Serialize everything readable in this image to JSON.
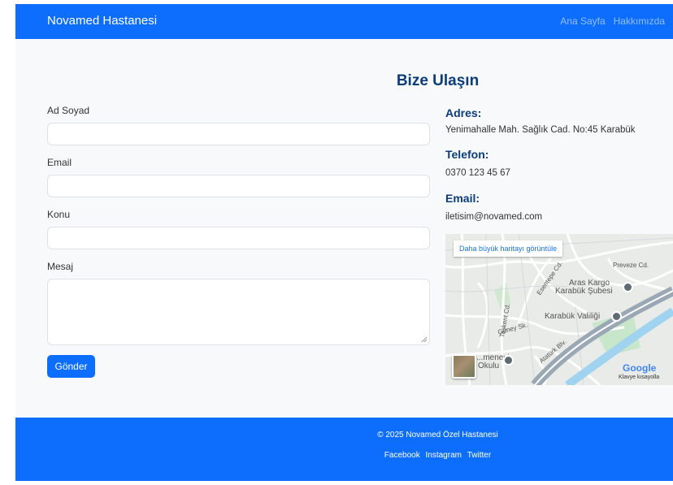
{
  "navbar": {
    "brand": "Novamed Hastanesi",
    "links": [
      "Ana Sayfa",
      "Hakkımızda"
    ]
  },
  "page_title": "Bize Ulaşın",
  "form": {
    "name_label": "Ad Soyad",
    "email_label": "Email",
    "subject_label": "Konu",
    "message_label": "Mesaj",
    "name_value": "",
    "email_value": "",
    "subject_value": "",
    "message_value": "",
    "submit_label": "Gönder"
  },
  "contact": {
    "address_heading": "Adres:",
    "address": "Yenimahalle Mah. Sağlık Cad. No:45 Karabük",
    "phone_heading": "Telefon:",
    "phone": "0370 123 45 67",
    "email_heading": "Email:",
    "email": "iletisim@novamed.com"
  },
  "map": {
    "larger_map_link": "Daha büyük haritayı görüntüle",
    "labels": {
      "cargo_1": "Aras Kargo",
      "cargo_2": "Karabük Şubesi",
      "governor": "Karabük Valiliği",
      "okulu_1": "...menevi",
      "okulu_2": "Okulu",
      "street_preveze": "Preveze Cd.",
      "street_esentepe": "Esentepe Cd.",
      "street_taskent": "Taşkent Cd.",
      "street_guney": "Güney Sk.",
      "street_ataturk": "Atatürk Blv."
    },
    "google": "Google",
    "credit": "Klavye kısayolla"
  },
  "footer": {
    "copyright": "© 2025 Novamed Özel Hastanesi",
    "social": [
      "Facebook",
      "Instagram",
      "Twitter"
    ]
  },
  "colors": {
    "primary": "#0d6efd",
    "heading": "#0b3d7a",
    "background": "#f8f9fa"
  }
}
